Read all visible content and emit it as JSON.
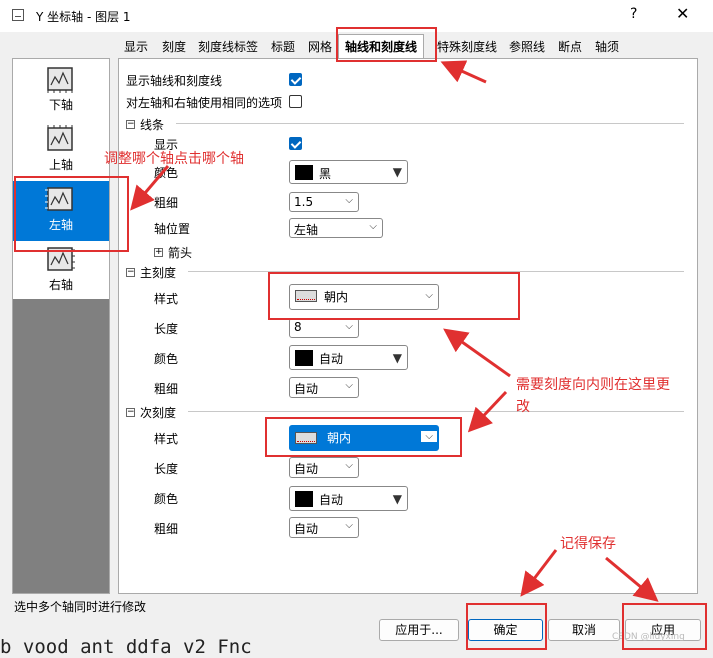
{
  "window": {
    "title": "Y 坐标轴 - 图层 1",
    "help": "?",
    "close": "✕"
  },
  "axes": [
    {
      "label": "下轴",
      "icon": "axis-bottom-icon",
      "selected": false
    },
    {
      "label": "上轴",
      "icon": "axis-top-icon",
      "selected": false
    },
    {
      "label": "左轴",
      "icon": "axis-left-icon",
      "selected": true
    },
    {
      "label": "右轴",
      "icon": "axis-right-icon",
      "selected": false
    }
  ],
  "tabs": [
    "显示",
    "刻度",
    "刻度线标签",
    "标题",
    "网格",
    "轴线和刻度线",
    "特殊刻度线",
    "参照线",
    "断点",
    "轴须"
  ],
  "active_tab": "轴线和刻度线",
  "top": {
    "show_axis_label": "显示轴线和刻度线",
    "show_axis_checked": true,
    "same_options_label": "对左轴和右轴使用相同的选项",
    "same_options_checked": false
  },
  "line": {
    "section": "线条",
    "show_label": "显示",
    "show_checked": true,
    "color_label": "颜色",
    "color_value": "黑",
    "width_label": "粗细",
    "width_value": "1.5",
    "position_label": "轴位置",
    "position_value": "左轴",
    "arrow_label": "箭头"
  },
  "major": {
    "section": "主刻度",
    "style_label": "样式",
    "style_value": "朝内",
    "length_label": "长度",
    "length_value": "8",
    "color_label": "颜色",
    "color_value": "自动",
    "width_label": "粗细",
    "width_value": "自动"
  },
  "minor": {
    "section": "次刻度",
    "style_label": "样式",
    "style_value": "朝内",
    "length_label": "长度",
    "length_value": "自动",
    "color_label": "颜色",
    "color_value": "自动",
    "width_label": "粗细",
    "width_value": "自动"
  },
  "status": "选中多个轴同时进行修改",
  "buttons": {
    "apply_to": "应用于...",
    "ok": "确定",
    "cancel": "取消",
    "apply": "应用"
  },
  "annotations": {
    "axis_hint": "调整哪个轴点击哪个轴",
    "tick_hint_1": "需要刻度向内则在这里更",
    "tick_hint_2": "改",
    "save_hint": "记得保存"
  },
  "background_text": "b vood ant ddfa v2 Fnc",
  "watermark": "CSDN @liuyxing",
  "colors": {
    "accent": "#0078d7",
    "annotation": "#e03030"
  }
}
